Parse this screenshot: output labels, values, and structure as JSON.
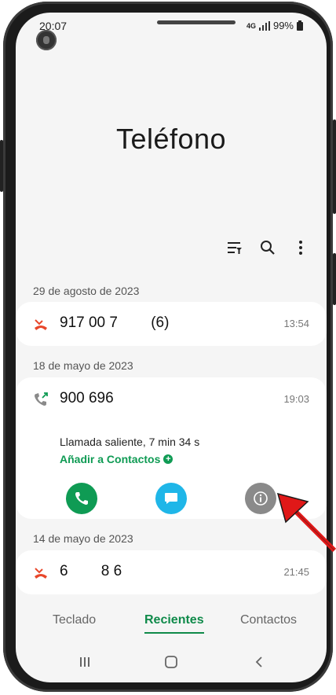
{
  "status": {
    "time": "20:07",
    "network": "4G",
    "battery": "99%"
  },
  "app": {
    "title": "Teléfono"
  },
  "toolbar": {
    "filter_icon": "filter-icon",
    "search_icon": "search-icon",
    "more_icon": "more-vertical-icon"
  },
  "groups": [
    {
      "date": "29 de agosto de 2023",
      "calls": [
        {
          "number": "917 00 7        (6)",
          "time": "13:54",
          "type": "missed"
        }
      ]
    },
    {
      "date": "18 de mayo de 2023",
      "calls": [
        {
          "number": "900 696",
          "time": "19:03",
          "type": "outgoing",
          "detail": "Llamada saliente, 7 min 34 s",
          "add_contact": "Añadir a Contactos"
        }
      ]
    },
    {
      "date": "14 de mayo de 2023",
      "calls": [
        {
          "number": "6        8 6",
          "time": "21:45",
          "type": "missed"
        }
      ]
    }
  ],
  "actions": {
    "call_icon": "phone-icon",
    "message_icon": "message-icon",
    "info_icon": "info-icon"
  },
  "tabs": [
    {
      "label": "Teclado"
    },
    {
      "label": "Recientes",
      "active": true
    },
    {
      "label": "Contactos"
    }
  ],
  "colors": {
    "accent": "#0f9b54",
    "missed": "#e8472b",
    "info": "#8a8a8a",
    "message": "#1fb6e8",
    "arrow": "#e01818"
  }
}
